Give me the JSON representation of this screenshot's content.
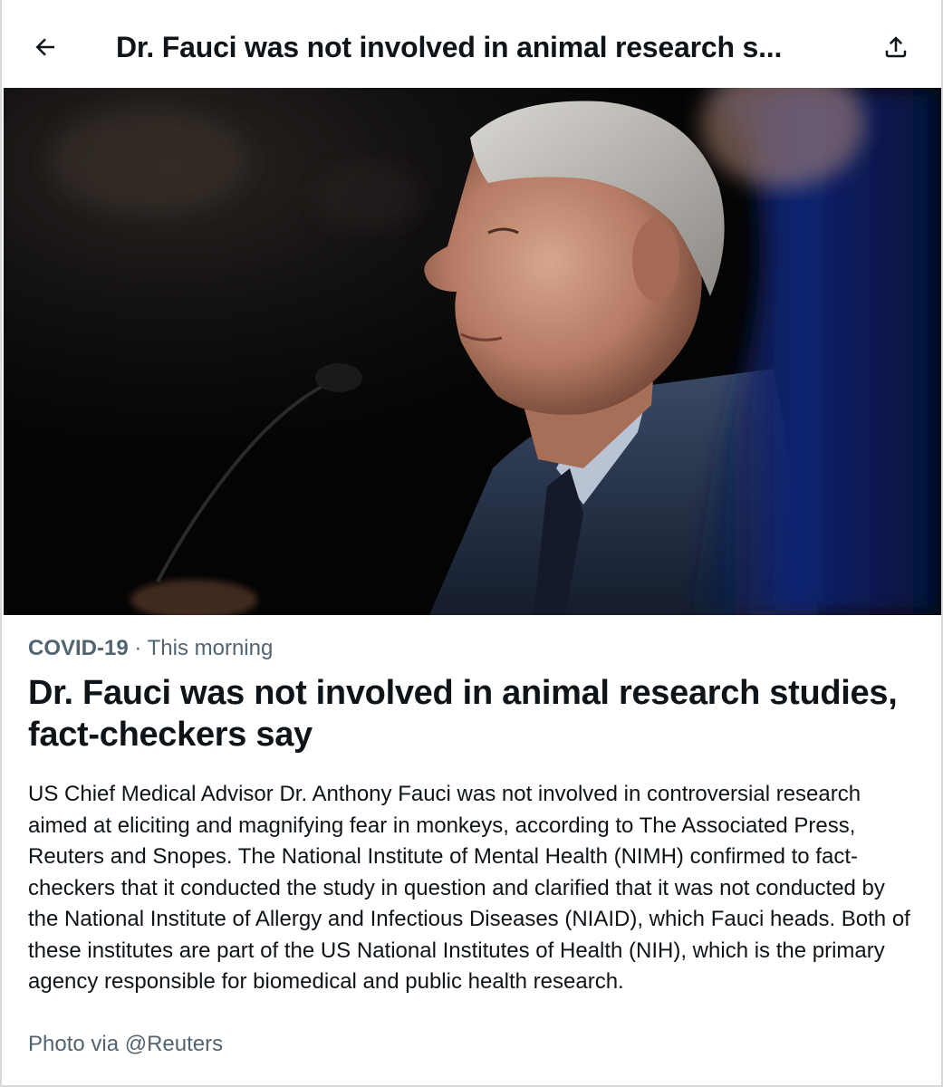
{
  "header": {
    "title": "Dr. Fauci was not involved in animal research s...",
    "back_icon": "arrow-left-icon",
    "share_icon": "share-upload-icon"
  },
  "hero_image": {
    "description_icon": "news-photo"
  },
  "article": {
    "topic": "COVID-19",
    "separator": " · ",
    "time": "This morning",
    "headline": "Dr. Fauci was not involved in animal research studies, fact-checkers say",
    "body": "US Chief Medical Advisor Dr. Anthony Fauci was not involved in controversial research aimed at eliciting and magnifying fear in monkeys, according to The Associated Press, Reuters and Snopes. The National Institute of Mental Health (NIMH) confirmed to fact-checkers that it conducted the study in question and clarified that it was not conducted by the National Institute of Allergy and Infectious Diseases (NIAID), which Fauci heads. Both of these institutes are part of the US National Institutes of Health (NIH), which is the primary agency responsible for biomedical and public health research.",
    "credit": "Photo via @Reuters"
  },
  "colors": {
    "text_primary": "#0f1419",
    "text_secondary": "#536471",
    "background": "#ffffff"
  }
}
